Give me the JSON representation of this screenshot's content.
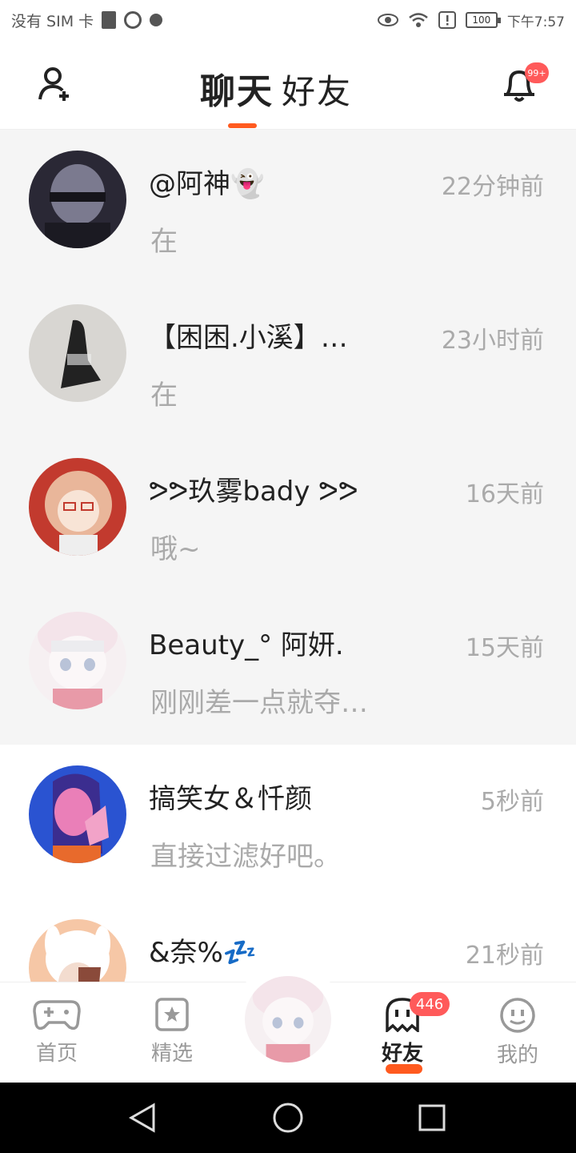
{
  "status_bar": {
    "carrier": "没有 SIM 卡",
    "battery": "100",
    "time": "下午7:57"
  },
  "header": {
    "tabs": [
      {
        "label": "聊天",
        "active": true
      },
      {
        "label": "好友",
        "active": false
      }
    ],
    "notification_badge": "99+",
    "icons": {
      "left": "add-user-icon",
      "right": "bell-icon"
    },
    "accent_color": "#ff5a1f"
  },
  "chats": [
    {
      "name": "@阿神👻",
      "time": "22分钟前",
      "message": "在",
      "avatar_colors": [
        "#2a2835",
        "#7b7a8f"
      ]
    },
    {
      "name": "【困困.小溪】…",
      "time": "23小时前",
      "message": "在",
      "avatar_colors": [
        "#d8d6d2",
        "#222222"
      ]
    },
    {
      "name": "ᕗᕗ玖雾bady ᕗᕗ",
      "time": "16天前",
      "message": "哦~",
      "avatar_colors": [
        "#e9b69a",
        "#c23a2e"
      ]
    },
    {
      "name": "Beauty_° 阿妍.",
      "time": "15天前",
      "message": "刚刚差一点就夺…",
      "avatar_colors": [
        "#f4e4ea",
        "#b9c3d8"
      ]
    },
    {
      "name": "搞笑女＆忏颜",
      "time": "5秒前",
      "message": "直接过滤好吧。",
      "avatar_colors": [
        "#2a53d1",
        "#ea7fb8"
      ]
    },
    {
      "name": "&奈%💤",
      "time": "21秒前",
      "message": "",
      "avatar_colors": [
        "#f6c7a6",
        "#ffffff"
      ]
    }
  ],
  "bottom_nav": {
    "items": [
      {
        "label": "首页",
        "icon": "gamepad-icon"
      },
      {
        "label": "精选",
        "icon": "star-icon"
      },
      {
        "label": "好友",
        "icon": "ghost-icon",
        "active": true,
        "badge": "446"
      },
      {
        "label": "我的",
        "icon": "smile-icon"
      }
    ]
  },
  "system_nav": {
    "icons": [
      "back-icon",
      "home-icon",
      "recents-icon"
    ]
  }
}
